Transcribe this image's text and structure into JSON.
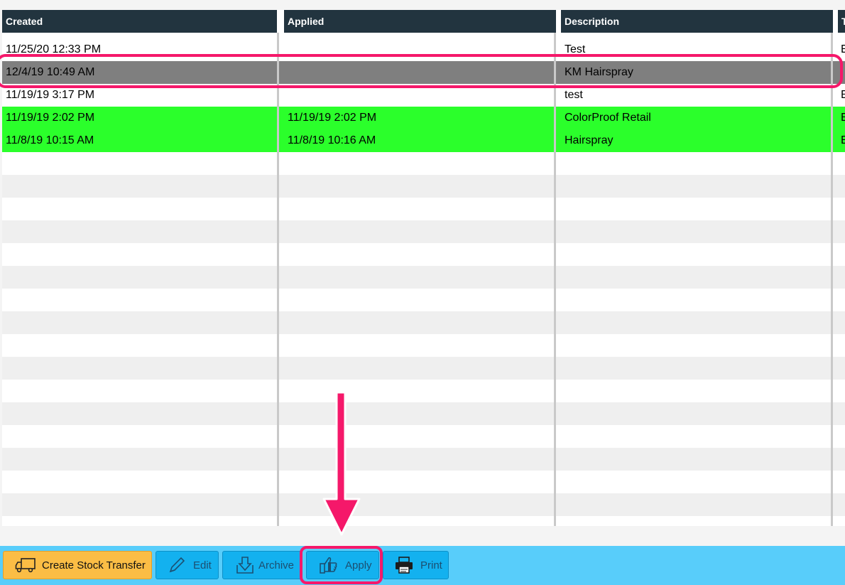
{
  "table": {
    "columns": [
      "Created",
      "Applied",
      "Description",
      "T"
    ],
    "rows": [
      {
        "created": "11/25/20 12:33 PM",
        "applied": "",
        "description": "Test",
        "extra": "E"
      },
      {
        "created": "12/4/19 10:49 AM",
        "applied": "",
        "description": "KM Hairspray",
        "extra": ""
      },
      {
        "created": "11/19/19 3:17 PM",
        "applied": "",
        "description": "test",
        "extra": "E"
      },
      {
        "created": "11/19/19 2:02 PM",
        "applied": "11/19/19 2:02 PM",
        "description": "ColorProof Retail",
        "extra": "E"
      },
      {
        "created": "11/8/19 10:15 AM",
        "applied": "11/8/19 10:16 AM",
        "description": "Hairspray",
        "extra": "E"
      }
    ]
  },
  "toolbar": {
    "create_label": "Create Stock Transfer",
    "edit_label": "Edit",
    "archive_label": "Archive",
    "apply_label": "Apply",
    "print_label": "Print"
  },
  "colors": {
    "header_bg": "#22343f",
    "selected_row": "#7f7f7f",
    "applied_row": "#2bff2b",
    "toolbar_bg": "#58cdfa",
    "button_blue": "#13b1ef",
    "button_orange": "#fbbd45",
    "highlight": "#f5186a"
  }
}
